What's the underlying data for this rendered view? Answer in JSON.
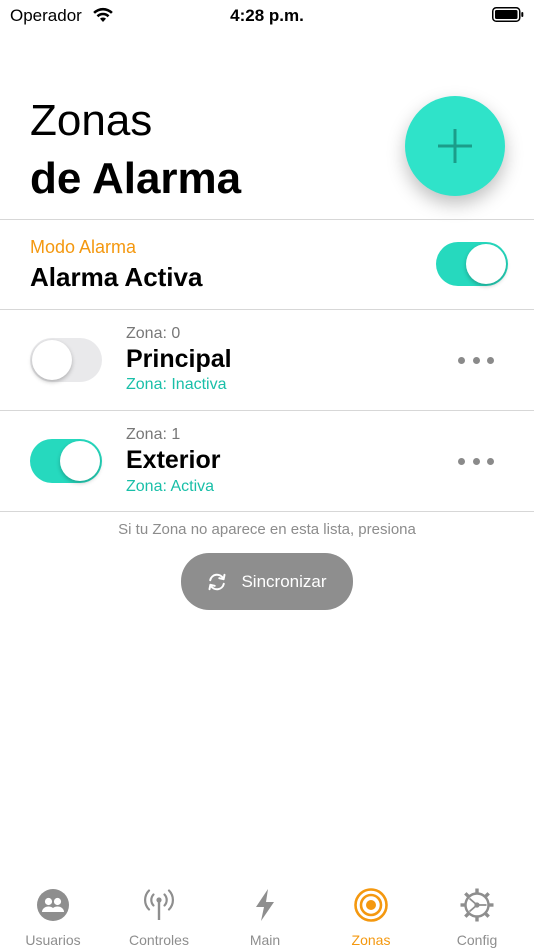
{
  "status_bar": {
    "carrier": "Operador",
    "time": "4:28 p.m."
  },
  "header": {
    "title_line1": "Zonas",
    "title_line2": "de Alarma"
  },
  "alarm_mode": {
    "label": "Modo Alarma",
    "status": "Alarma Activa",
    "enabled": true
  },
  "zones": [
    {
      "number_label": "Zona: 0",
      "name": "Principal",
      "state_label": "Zona: Inactiva",
      "enabled": false
    },
    {
      "number_label": "Zona: 1",
      "name": "Exterior",
      "state_label": "Zona: Activa",
      "enabled": true
    }
  ],
  "hint": "Si tu Zona no aparece en esta lista, presiona",
  "sync_button": {
    "label": "Sincronizar"
  },
  "tabs": [
    {
      "label": "Usuarios",
      "icon": "users-icon",
      "active": false
    },
    {
      "label": "Controles",
      "icon": "antenna-icon",
      "active": false
    },
    {
      "label": "Main",
      "icon": "lightning-icon",
      "active": false
    },
    {
      "label": "Zonas",
      "icon": "target-icon",
      "active": true
    },
    {
      "label": "Config",
      "icon": "gear-icon",
      "active": false
    }
  ],
  "colors": {
    "accent": "#2fe3c9",
    "toggle_on": "#26d9be",
    "orange": "#f4980f",
    "active_text": "#19bfa8",
    "gray": "#8e8e8e"
  }
}
